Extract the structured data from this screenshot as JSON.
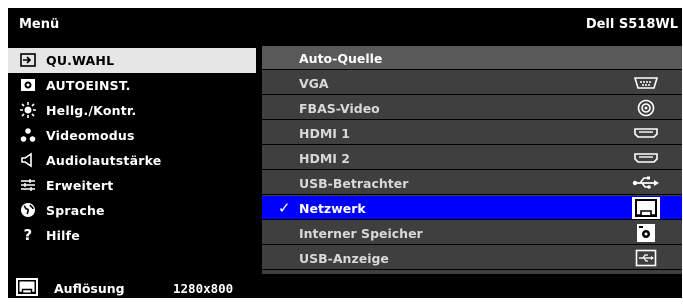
{
  "header": {
    "title": "Menü",
    "model": "Dell S518WL"
  },
  "menu": [
    {
      "label": "QU.WAHL",
      "icon": "input-source-icon",
      "selected": true
    },
    {
      "label": "AUTOEINST.",
      "icon": "auto-adjust-icon"
    },
    {
      "label": "Hellg./Kontr.",
      "icon": "brightness-icon"
    },
    {
      "label": "Videomodus",
      "icon": "video-mode-icon"
    },
    {
      "label": "Audiolautstärke",
      "icon": "speaker-icon"
    },
    {
      "label": "Erweitert",
      "icon": "advanced-settings-icon"
    },
    {
      "label": "Sprache",
      "icon": "globe-icon"
    },
    {
      "label": "Hilfe",
      "icon": "help-icon"
    }
  ],
  "panel": {
    "title": "Auto-Quelle",
    "sources": [
      {
        "label": "VGA",
        "icon": "vga-port-icon"
      },
      {
        "label": "FBAS-Video",
        "icon": "composite-video-icon"
      },
      {
        "label": "HDMI 1",
        "icon": "hdmi-port-icon"
      },
      {
        "label": "HDMI 2",
        "icon": "hdmi-port-icon"
      },
      {
        "label": "USB-Betrachter",
        "icon": "usb-icon"
      },
      {
        "label": "Netzwerk",
        "icon": "network-icon",
        "selected": true,
        "checked": true
      },
      {
        "label": "Interner Speicher",
        "icon": "internal-storage-icon"
      },
      {
        "label": "USB-Anzeige",
        "icon": "usb-display-icon"
      }
    ]
  },
  "footer": {
    "resolution_label": "Auflösung",
    "resolution_value": "1280x800",
    "icon": "network-icon"
  },
  "colors": {
    "background": "#000000",
    "selected_menu": "#e6e6e6",
    "selected_source": "#0000ff",
    "panel": "#3f3f3f",
    "panel_header": "#595959"
  }
}
